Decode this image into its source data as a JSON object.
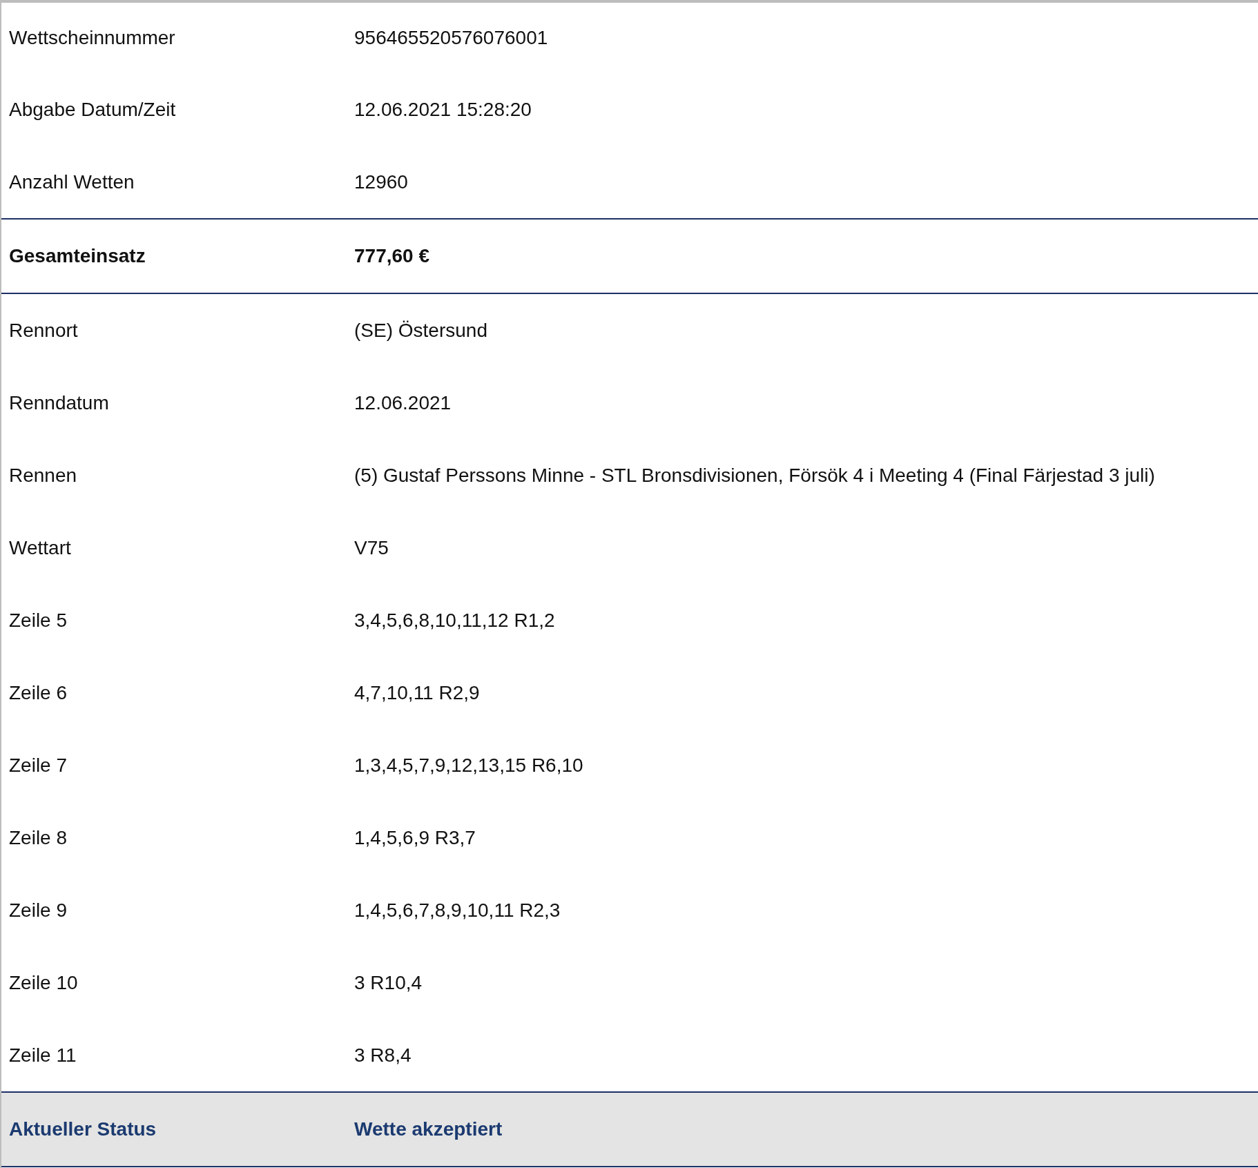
{
  "rows": [
    {
      "kind": "normal",
      "label": "Wettscheinnummer",
      "value": "956465520576076001"
    },
    {
      "kind": "normal",
      "label": "Abgabe Datum/Zeit",
      "value": "12.06.2021 15:28:20"
    },
    {
      "kind": "normal",
      "label": "Anzahl Wetten",
      "value": "12960"
    },
    {
      "kind": "total",
      "label": "Gesamteinsatz",
      "value": "777,60 €"
    },
    {
      "kind": "normal",
      "label": "Rennort",
      "value": "(SE) Östersund"
    },
    {
      "kind": "normal",
      "label": "Renndatum",
      "value": "12.06.2021"
    },
    {
      "kind": "normal",
      "label": "Rennen",
      "value": "(5) Gustaf Perssons Minne - STL Bronsdivisionen, Försök 4 i Meeting 4 (Final Färjestad 3 juli)"
    },
    {
      "kind": "normal",
      "label": "Wettart",
      "value": "V75"
    },
    {
      "kind": "normal",
      "label": "Zeile 5",
      "value": "3,4,5,6,8,10,11,12 R1,2"
    },
    {
      "kind": "normal",
      "label": "Zeile 6",
      "value": "4,7,10,11 R2,9"
    },
    {
      "kind": "normal",
      "label": "Zeile 7",
      "value": "1,3,4,5,7,9,12,13,15 R6,10"
    },
    {
      "kind": "normal",
      "label": "Zeile 8",
      "value": "1,4,5,6,9 R3,7"
    },
    {
      "kind": "normal",
      "label": "Zeile 9",
      "value": "1,4,5,6,7,8,9,10,11 R2,3"
    },
    {
      "kind": "normal",
      "label": "Zeile 10",
      "value": "3 R10,4"
    },
    {
      "kind": "normal",
      "label": "Zeile 11",
      "value": "3 R8,4"
    },
    {
      "kind": "status",
      "label": "Aktueller Status",
      "value": "Wette akzeptiert"
    }
  ]
}
